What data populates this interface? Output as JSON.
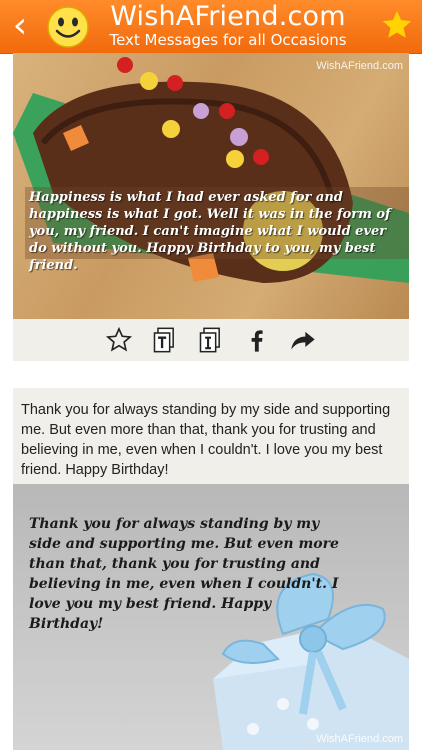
{
  "header": {
    "title": "WishAFriend.com",
    "subtitle": "Text Messages for all Occasions"
  },
  "card1": {
    "watermark": "WishAFriend.com",
    "message": "Happiness is what I had ever asked for and happiness is what I got. Well it was in the form of you, my friend. I can't imagine what I would ever do without you. Happy Birthday to you, my best friend."
  },
  "card2": {
    "text": "Thank you for always standing by my side and supporting me. But even more than that, thank you for trusting and believing in me, even when I couldn't. I love you my best friend. Happy Birthday!",
    "card_message": "Thank you for always standing by my side and supporting me. But even more than that, thank you for trusting and believing in me, even when I couldn't. I love you my best friend. Happy Birthday!",
    "watermark": "WishAFriend.com"
  },
  "colors": {
    "header_orange": "#f26a0c",
    "favorite_star": "#ffd400"
  },
  "icons": [
    "back-icon",
    "smiley-icon",
    "favorite-star-icon",
    "star-outline-icon",
    "text-copy-icon",
    "image-copy-icon",
    "facebook-icon",
    "share-icon"
  ]
}
